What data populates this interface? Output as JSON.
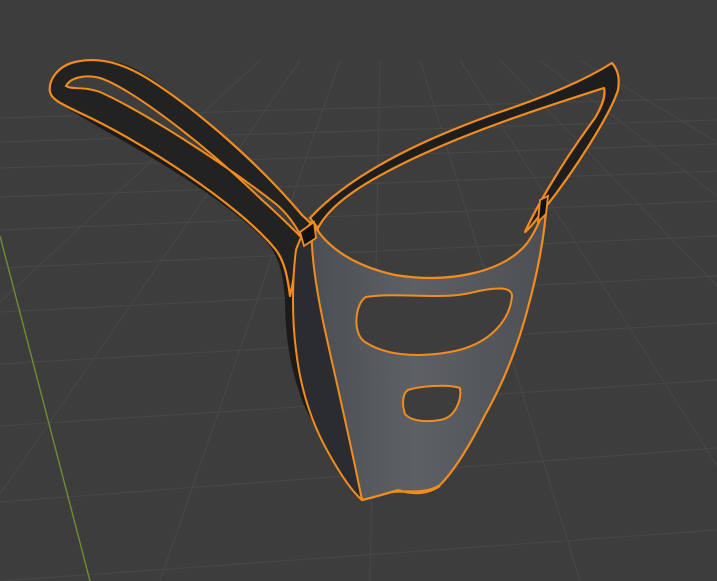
{
  "viewport": {
    "background_color": "#3d3d3d",
    "grid_color": "#4a4a4a",
    "grid_minor_color": "#434343",
    "y_axis_color": "#6a8c2f"
  },
  "object": {
    "selected": true,
    "outline_color": "#f28c1f",
    "surface_color": "#5a5d61",
    "surface_dark_color": "#2a2a2a",
    "backface_color": "#1a1a1a"
  }
}
